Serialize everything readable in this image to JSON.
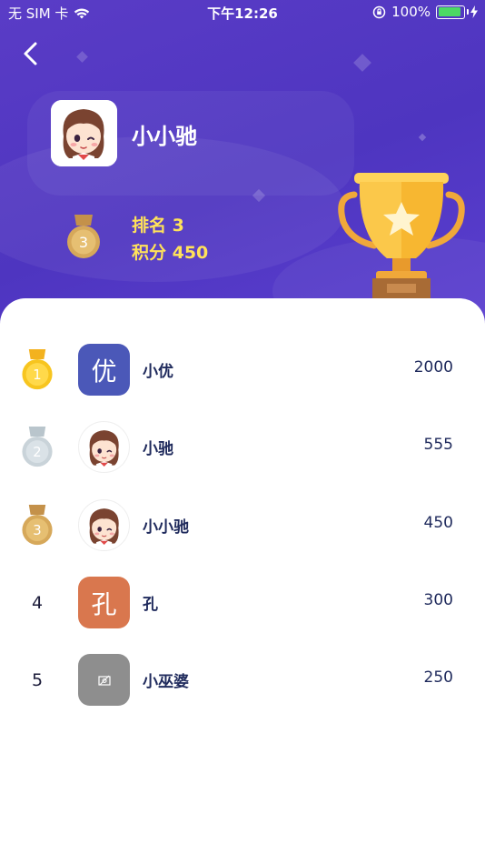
{
  "status_bar": {
    "carrier": "无 SIM 卡",
    "time": "下午12:26",
    "battery": "100%"
  },
  "header": {
    "user_name": "小小驰",
    "rank_text": "排名 3",
    "score_text": "积分 450",
    "my_medal": "3"
  },
  "ranking": [
    {
      "rank": "1",
      "medal": "gold",
      "avatar_type": "text",
      "avatar_char": "优",
      "avatar_color": "#4b58b8",
      "name": "小优",
      "score": "2000"
    },
    {
      "rank": "2",
      "medal": "silver",
      "avatar_type": "girl",
      "name": "小驰",
      "score": "555"
    },
    {
      "rank": "3",
      "medal": "bronze",
      "avatar_type": "girl",
      "name": "小小驰",
      "score": "450"
    },
    {
      "rank": "4",
      "medal": "none",
      "avatar_type": "text",
      "avatar_char": "孔",
      "avatar_color": "#d9774e",
      "name": "孔",
      "score": "300"
    },
    {
      "rank": "5",
      "medal": "none",
      "avatar_type": "broken-image",
      "avatar_color": "#8e8e8e",
      "name": "小巫婆",
      "score": "250"
    }
  ],
  "colors": {
    "header_bg": "#5a3cc6",
    "highlight_text": "#ffe25a",
    "gold": "#f5c518",
    "silver": "#c9d3d9",
    "bronze": "#d6a85a",
    "name_text": "#1f2a5c"
  }
}
